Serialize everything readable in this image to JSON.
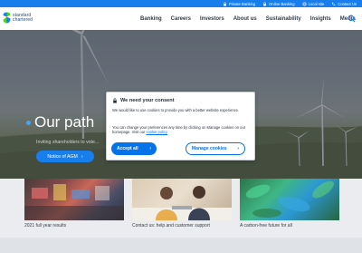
{
  "utility_bar": {
    "links": [
      {
        "label": "Private Banking",
        "icon": "lock-icon"
      },
      {
        "label": "Online Banking",
        "icon": "lock-icon"
      },
      {
        "label": "Local site",
        "icon": "globe-icon"
      },
      {
        "label": "Contact Us",
        "icon": "phone-icon"
      }
    ]
  },
  "brand": {
    "line1": "standard",
    "line2": "chartered"
  },
  "nav": {
    "items": [
      "Banking",
      "Careers",
      "Investors",
      "About us",
      "Sustainability",
      "Insights",
      "Media"
    ]
  },
  "hero": {
    "title": "Our path",
    "subtitle": "Inviting shareholders to vote...",
    "cta_label": "Notice of AGM"
  },
  "cards": [
    {
      "label": "2021 full year results"
    },
    {
      "label": "Contact us: help and customer support"
    },
    {
      "label": "A carbon-free future for all"
    }
  ],
  "consent": {
    "title": "We need your consent",
    "body1": "We would like to use cookies to provide you with a better website experience.",
    "body2_prefix": "You can change your preferences any time by clicking on Manage cookies on our homepage. Visit our ",
    "policy_link": "cookie policy",
    "accept_label": "Accept all",
    "manage_label": "Manage cookies"
  },
  "colors": {
    "brand_blue": "#0473ea",
    "brand_navy": "#0a3f72",
    "brand_green": "#38d200"
  }
}
